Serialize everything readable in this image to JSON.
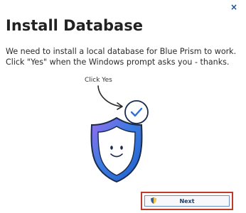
{
  "window": {
    "close_symbol": "×",
    "close_icon": "close-icon"
  },
  "title": "Install Database",
  "body": {
    "line1": "We need to install a local database for Blue Prism to work.",
    "line2": "Click \"Yes\" when the Windows prompt asks you - thanks."
  },
  "illustration": {
    "annotation": "Click Yes",
    "icon": "shield-check-icon",
    "shield_color": "#2e6fd8",
    "shield_accent": "#8b5cf6",
    "check_color": "#2e6fd8"
  },
  "footer": {
    "next_label": "Next",
    "next_icon": "uac-shield-icon",
    "highlight_color": "#c0392b"
  }
}
